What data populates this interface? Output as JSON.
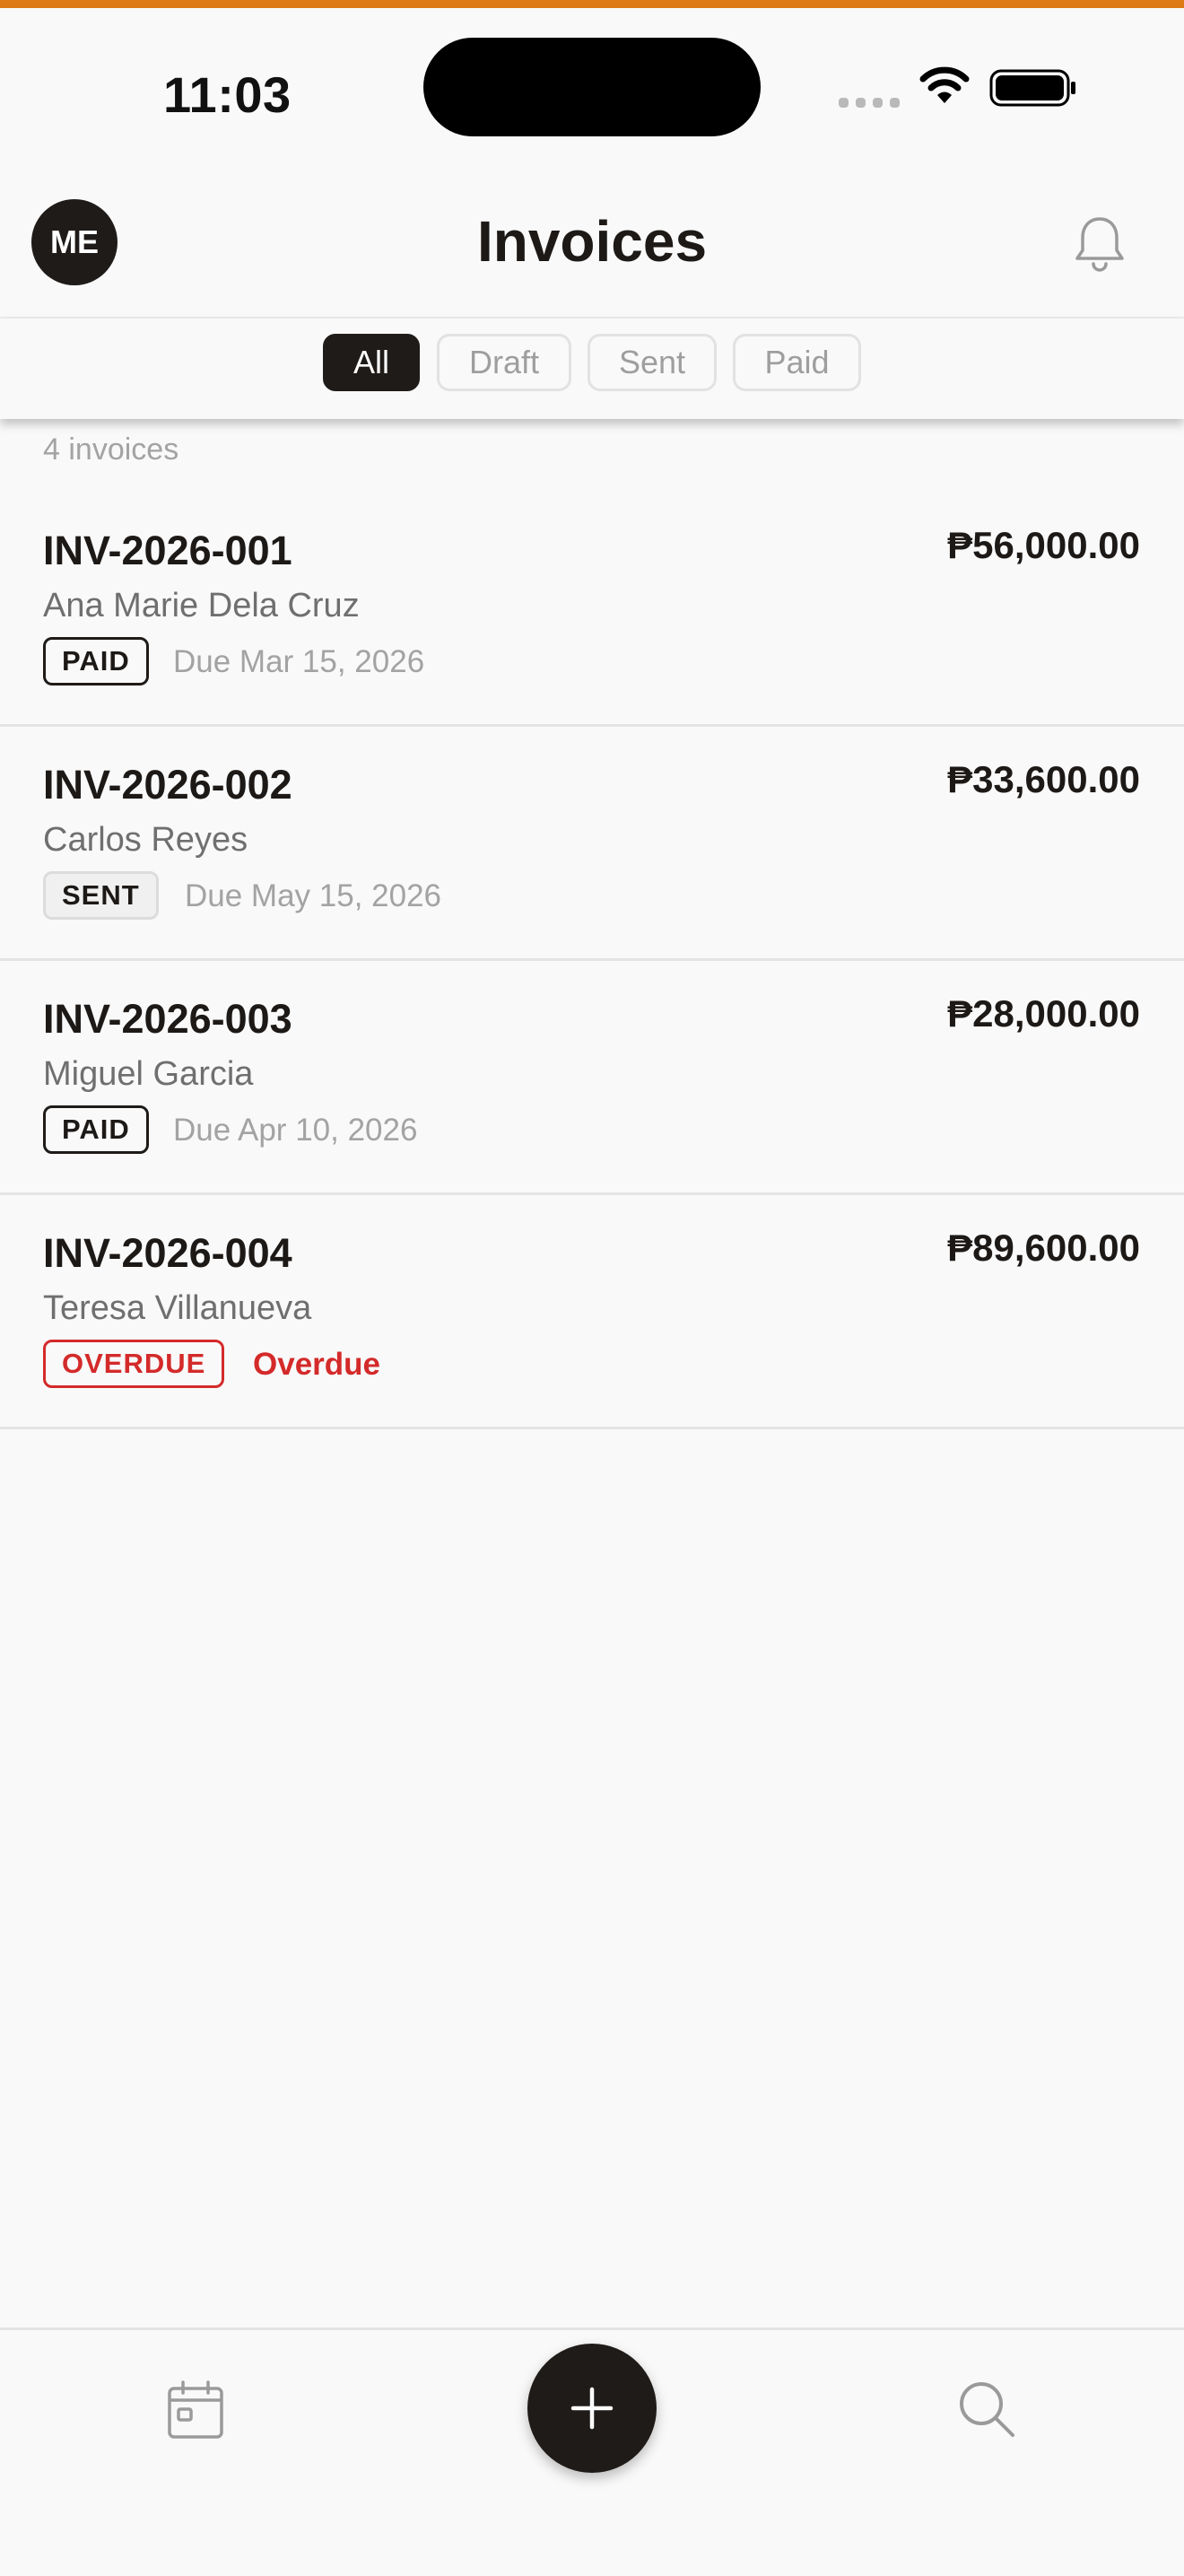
{
  "status_bar": {
    "time": "11:03"
  },
  "header": {
    "avatar_initials": "ME",
    "title": "Invoices"
  },
  "filters": [
    {
      "label": "All",
      "active": true
    },
    {
      "label": "Draft",
      "active": false
    },
    {
      "label": "Sent",
      "active": false
    },
    {
      "label": "Paid",
      "active": false
    }
  ],
  "list": {
    "count_text": "4 invoices",
    "invoices": [
      {
        "number": "INV-2026-001",
        "client": "Ana Marie Dela Cruz",
        "amount": "₱56,000.00",
        "status": "PAID",
        "due": "Due Mar 15, 2026"
      },
      {
        "number": "INV-2026-002",
        "client": "Carlos Reyes",
        "amount": "₱33,600.00",
        "status": "SENT",
        "due": "Due May 15, 2026"
      },
      {
        "number": "INV-2026-003",
        "client": "Miguel Garcia",
        "amount": "₱28,000.00",
        "status": "PAID",
        "due": "Due Apr 10, 2026"
      },
      {
        "number": "INV-2026-004",
        "client": "Teresa Villanueva",
        "amount": "₱89,600.00",
        "status": "OVERDUE",
        "due": "Overdue"
      }
    ]
  },
  "bottom_nav": {
    "left_icon": "calendar-icon",
    "center_icon": "plus-icon",
    "right_icon": "search-icon"
  },
  "colors": {
    "accent": "#dd7a14",
    "primary": "#1e1b19",
    "overdue": "#d42a2a",
    "muted": "#a3a3a3"
  }
}
